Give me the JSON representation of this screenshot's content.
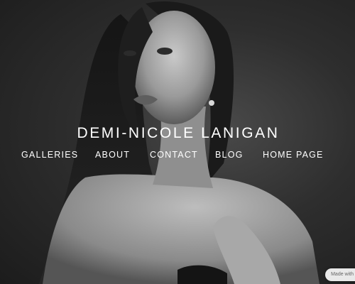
{
  "site": {
    "title": "DEMI-NICOLE LANIGAN"
  },
  "nav": {
    "items": [
      {
        "label": "GALLERIES"
      },
      {
        "label": "ABOUT"
      },
      {
        "label": "CONTACT"
      },
      {
        "label": "BLOG"
      },
      {
        "label": "HOME PAGE"
      }
    ]
  },
  "badge": {
    "label": "Made with"
  },
  "hero": {
    "icon": "portrait-photo",
    "style": "black-and-white"
  },
  "colors": {
    "text": "#ffffff",
    "background": "#2a2a2a"
  }
}
